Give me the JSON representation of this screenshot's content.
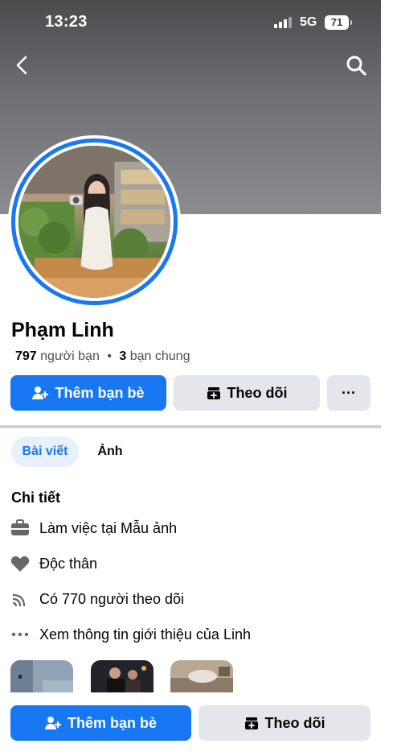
{
  "status_bar": {
    "time": "13:23",
    "network": "5G",
    "battery": "71"
  },
  "nav": {
    "back_icon": "chevron-left-icon",
    "search_icon": "search-icon"
  },
  "profile": {
    "name": "Phạm Linh",
    "friend_count": "797",
    "friends_label": "người bạn",
    "separator": "•",
    "mutual_count": "3",
    "mutual_label": "bạn chung"
  },
  "actions": {
    "add_friend_label": "Thêm bạn bè",
    "follow_label": "Theo dõi",
    "more_label": "···"
  },
  "tabs": [
    {
      "label": "Bài viết",
      "active": true
    },
    {
      "label": "Ảnh",
      "active": false
    }
  ],
  "details": {
    "title": "Chi tiết",
    "items": [
      {
        "icon": "briefcase-icon",
        "text": "Làm việc tại Mẫu ảnh"
      },
      {
        "icon": "heart-icon",
        "text": "Độc thân"
      },
      {
        "icon": "rss-icon",
        "text": "Có 770 người theo dõi"
      },
      {
        "icon": "more-dots-icon",
        "text": "Xem thông tin giới thiệu của Linh"
      }
    ]
  },
  "bottom_actions": {
    "add_friend_label": "Thêm bạn bè",
    "follow_label": "Theo dõi"
  },
  "colors": {
    "accent": "#1877f2",
    "secondary_button": "#e4e6eb",
    "active_tab_bg": "#e7f0fd",
    "text": "#050505",
    "muted_text": "#4b4f56"
  }
}
